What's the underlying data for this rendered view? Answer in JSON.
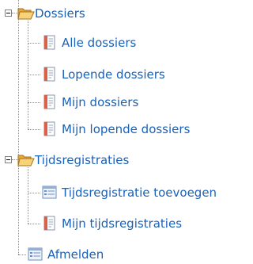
{
  "tree": {
    "groups": [
      {
        "label": "Dossiers",
        "icon": "folder-open-icon",
        "items": [
          {
            "label": "Alle dossiers",
            "icon": "document-icon"
          },
          {
            "label": "Lopende dossiers",
            "icon": "document-icon"
          },
          {
            "label": "Mijn dossiers",
            "icon": "document-icon"
          },
          {
            "label": "Mijn lopende dossiers",
            "icon": "document-icon"
          }
        ]
      },
      {
        "label": "Tijdsregistraties",
        "icon": "folder-open-icon",
        "items": [
          {
            "label": "Tijdsregistratie toevoegen",
            "icon": "form-icon"
          },
          {
            "label": "Mijn tijdsregistraties",
            "icon": "document-icon"
          }
        ]
      }
    ],
    "logout": {
      "label": "Afmelden",
      "icon": "form-icon"
    }
  },
  "colors": {
    "link": "#1a62b8",
    "connector": "#8a8a8a"
  }
}
